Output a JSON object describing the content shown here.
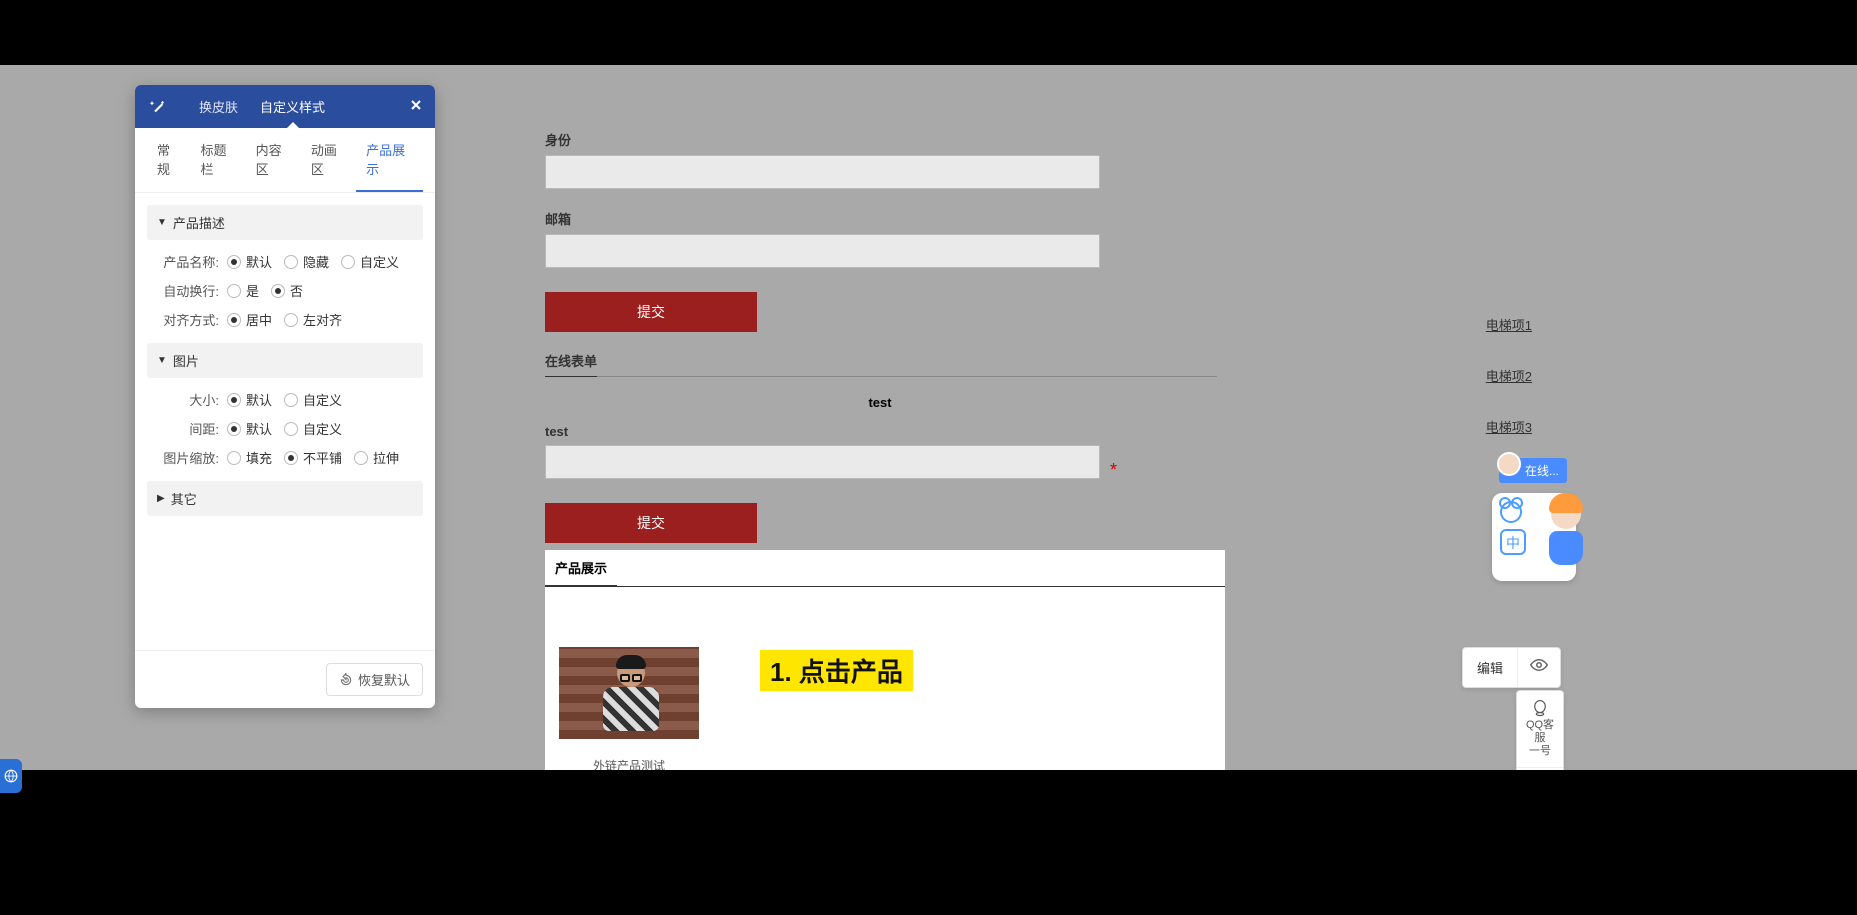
{
  "panel": {
    "headerTabs": [
      "换皮肤",
      "自定义样式"
    ],
    "activeHeaderTab": 1,
    "subTabs": [
      "常规",
      "标题栏",
      "内容区",
      "动画区",
      "产品展示"
    ],
    "activeSubTab": 4,
    "sections": {
      "desc": {
        "title": "产品描述",
        "rows": {
          "productName": {
            "label": "产品名称:",
            "opts": [
              "默认",
              "隐藏",
              "自定义"
            ],
            "sel": 0
          },
          "autoWrap": {
            "label": "自动换行:",
            "opts": [
              "是",
              "否"
            ],
            "sel": 1
          },
          "align": {
            "label": "对齐方式:",
            "opts": [
              "居中",
              "左对齐"
            ],
            "sel": 0
          }
        }
      },
      "image": {
        "title": "图片",
        "rows": {
          "size": {
            "label": "大小:",
            "opts": [
              "默认",
              "自定义"
            ],
            "sel": 0
          },
          "gap": {
            "label": "间距:",
            "opts": [
              "默认",
              "自定义"
            ],
            "sel": 0
          },
          "scale": {
            "label": "图片缩放:",
            "opts": [
              "填充",
              "不平铺",
              "拉伸"
            ],
            "sel": 1
          }
        }
      },
      "other": {
        "title": "其它"
      }
    },
    "resetBtn": "恢复默认"
  },
  "form": {
    "field1Label": "身份",
    "field2Label": "邮箱",
    "submit": "提交",
    "onlineFormTitle": "在线表单",
    "testHeading": "test",
    "testLabel": "test",
    "submit2": "提交"
  },
  "product": {
    "sectionTitle": "产品展示",
    "caption": "外链产品测试"
  },
  "annotation": "1. 点击产品",
  "elevator": [
    "电梯项1",
    "电梯项2",
    "电梯项3"
  ],
  "csBubble": "在线...",
  "mascotZh": "中",
  "editToggle": "编辑",
  "floatTools": {
    "qq": "QQ客服\n一号"
  }
}
